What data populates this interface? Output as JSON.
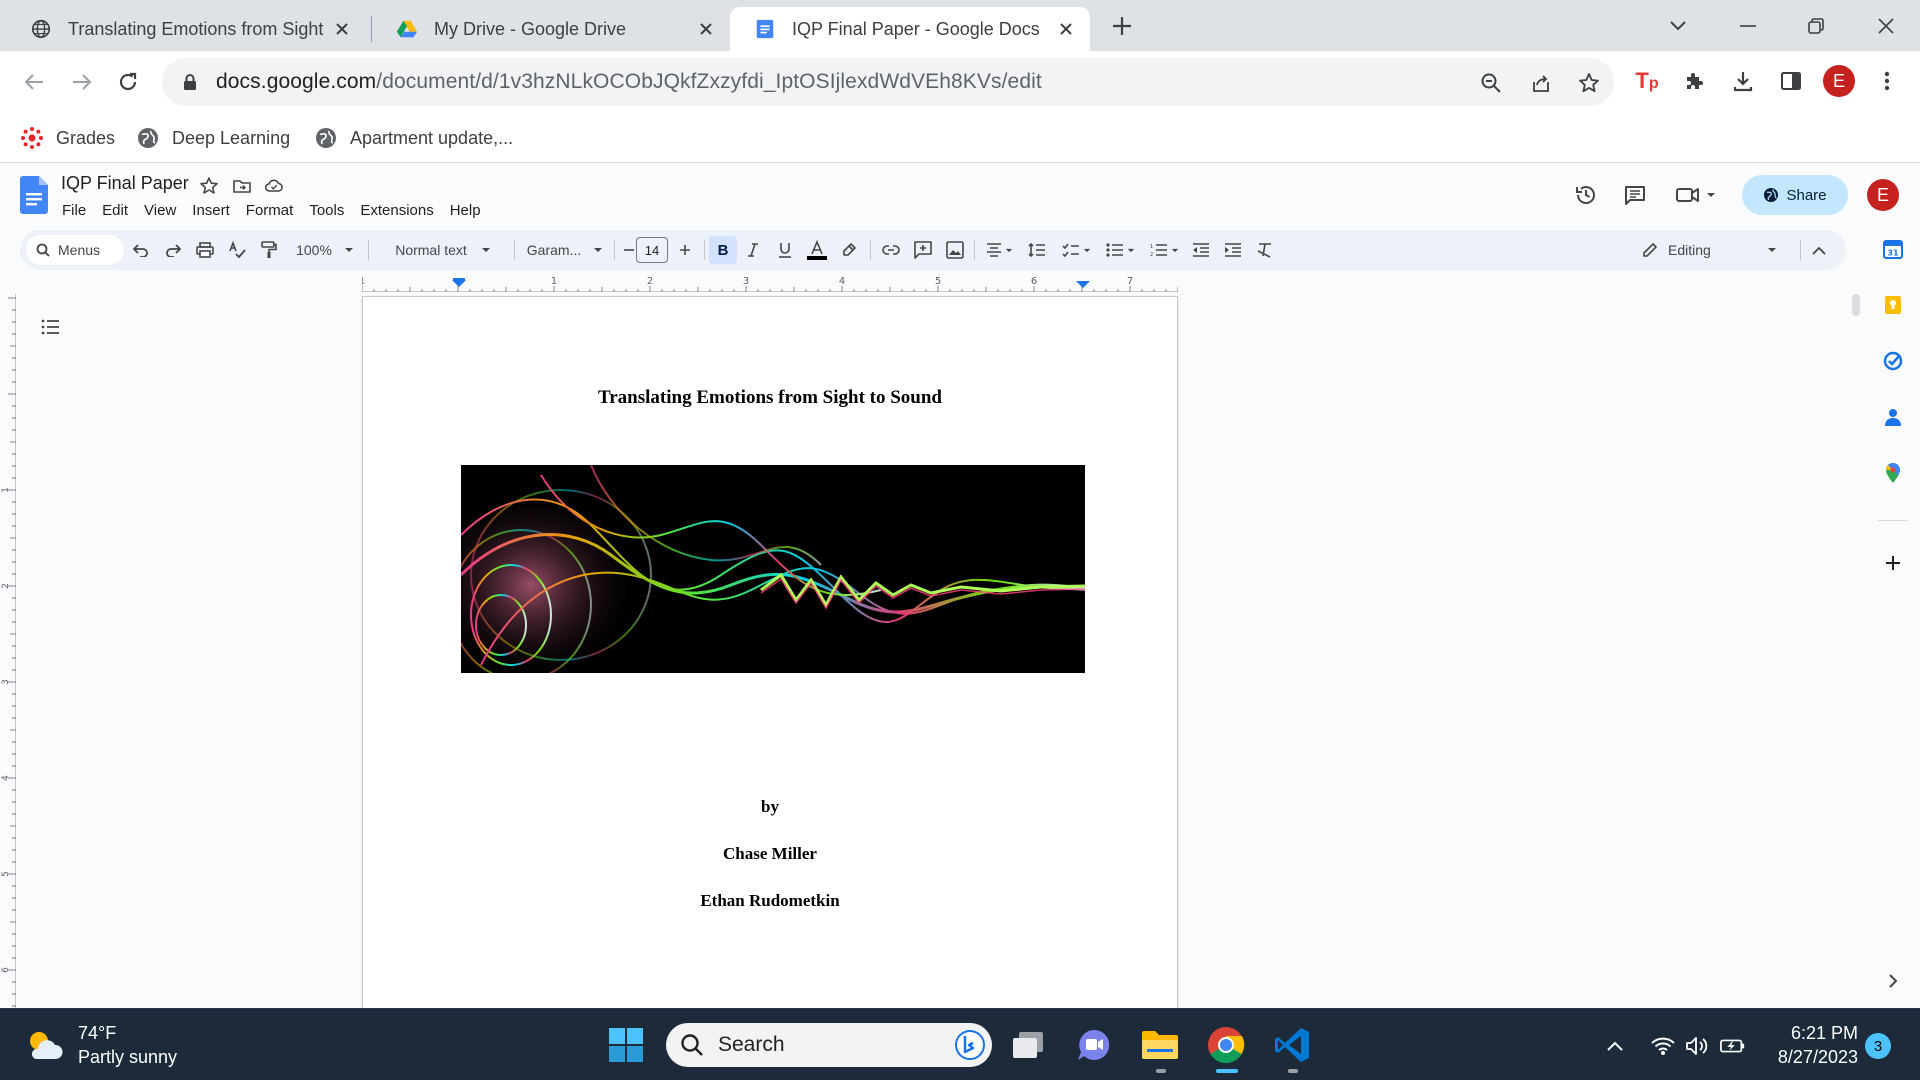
{
  "browser": {
    "tabs": [
      {
        "title": "Translating Emotions from Sight to",
        "icon": "globe-icon",
        "active": false
      },
      {
        "title": "My Drive - Google Drive",
        "icon": "google-drive-icon",
        "active": false
      },
      {
        "title": "IQP Final Paper - Google Docs",
        "icon": "google-docs-icon",
        "active": true
      }
    ],
    "url_host": "docs.google.com",
    "url_path": "/document/d/1v3hzNLkOCObJQkfZxzyfdi_IptOSIjlexdWdVEh8KVs/edit",
    "profile_initial": "E",
    "bookmarks": [
      {
        "label": "Grades",
        "icon": "canvas-icon"
      },
      {
        "label": "Deep Learning",
        "icon": "globe-icon"
      },
      {
        "label": "Apartment update,...",
        "icon": "globe-icon"
      }
    ]
  },
  "docs": {
    "doc_title": "IQP Final Paper",
    "menu": [
      "File",
      "Edit",
      "View",
      "Insert",
      "Format",
      "Tools",
      "Extensions",
      "Help"
    ],
    "share_label": "Share",
    "user_initial": "E",
    "toolbar": {
      "menus_label": "Menus",
      "zoom": "100%",
      "style": "Normal text",
      "font": "Garam...",
      "font_size": "14",
      "bold_label": "B",
      "mode": "Editing"
    },
    "ruler_labels": [
      "1",
      "1",
      "2",
      "3",
      "4",
      "5",
      "6",
      "7"
    ],
    "vruler_labels": [
      "1",
      "2",
      "3",
      "4",
      "5",
      "6"
    ],
    "page": {
      "heading": "Translating Emotions from Sight to Sound",
      "by": "by",
      "author1": "Chase Miller",
      "author2": "Ethan Rudometkin"
    }
  },
  "taskbar": {
    "temp": "74°F",
    "condition": "Partly sunny",
    "search_placeholder": "Search",
    "time": "6:21 PM",
    "date": "8/27/2023",
    "notifications": "3"
  },
  "colors": {
    "accent": "#1a73e8",
    "share_bg": "#c2e7ff",
    "avatar": "#c5221f",
    "taskbar": "#1c2a3a"
  }
}
